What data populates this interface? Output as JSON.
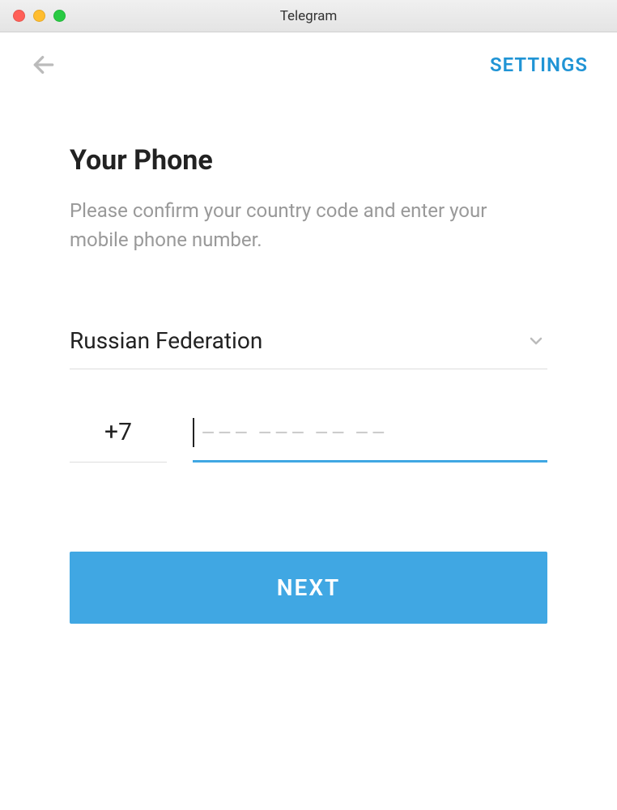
{
  "window": {
    "title": "Telegram"
  },
  "header": {
    "settings_label": "SETTINGS"
  },
  "page": {
    "title": "Your Phone",
    "subtitle": "Please confirm your country code and enter your mobile phone number."
  },
  "form": {
    "country_selected": "Russian Federation",
    "country_code": "+7",
    "phone_placeholder": "––– ––– –– ––",
    "next_label": "NEXT"
  }
}
